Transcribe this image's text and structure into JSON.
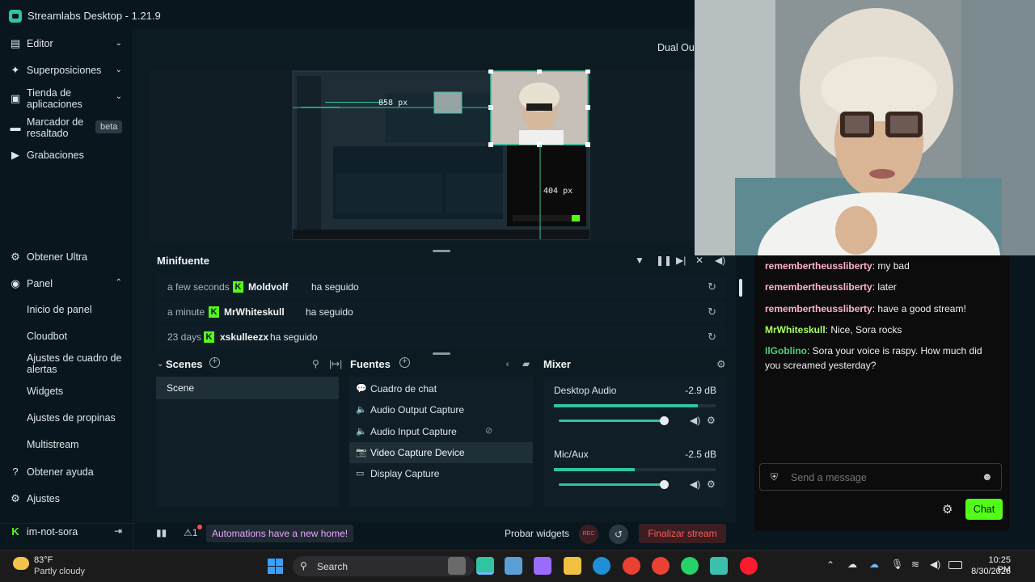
{
  "window": {
    "title": "Streamlabs Desktop - 1.21.9"
  },
  "sidebar": {
    "items": [
      {
        "label": "Editor",
        "icon": "editor-icon"
      },
      {
        "label": "Superposiciones",
        "icon": "overlays-icon"
      },
      {
        "label": "Tienda de aplicaciones",
        "icon": "app-store-icon"
      },
      {
        "label": "Marcador de resaltado",
        "icon": "highlighter-icon",
        "badge": "beta"
      },
      {
        "label": "Grabaciones",
        "icon": "recordings-icon"
      }
    ],
    "lower": [
      {
        "label": "Obtener Ultra",
        "icon": "ultra-icon"
      },
      {
        "label": "Panel",
        "icon": "dashboard-icon"
      }
    ],
    "sub_items": [
      "Inicio de panel",
      "Cloudbot",
      "Ajustes de cuadro de alertas",
      "Widgets",
      "Ajustes de propinas",
      "Multistream"
    ],
    "bottom": [
      {
        "label": "Obtener ayuda",
        "icon": "help-icon"
      },
      {
        "label": "Ajustes",
        "icon": "settings-icon"
      },
      {
        "label": "im-not-sora",
        "icon": "kick-icon"
      }
    ]
  },
  "preview": {
    "dual_output_label": "Dual Outp",
    "inner": {
      "width_readout": "858 px",
      "height_readout": "404 px"
    }
  },
  "minifuente": {
    "title": "Minifuente",
    "events": [
      {
        "time": "a few seconds",
        "user": "Moldvolf",
        "action": "ha seguido"
      },
      {
        "time": "a minute",
        "user": "MrWhiteskull",
        "action": "ha seguido"
      },
      {
        "time": "23 days",
        "user": "xskulleezx",
        "action": "ha seguido"
      }
    ]
  },
  "scenes": {
    "title": "Scenes",
    "items": [
      "Scene"
    ]
  },
  "fuentes": {
    "title": "Fuentes",
    "items": [
      {
        "label": "Cuadro de chat",
        "icon": "chat-box-icon"
      },
      {
        "label": "Audio Output Capture",
        "icon": "speaker-icon"
      },
      {
        "label": "Audio Input Capture",
        "icon": "speaker-icon"
      },
      {
        "label": "Video Capture Device",
        "icon": "camera-icon"
      },
      {
        "label": "Display Capture",
        "icon": "monitor-icon"
      }
    ]
  },
  "mixer": {
    "title": "Mixer",
    "channels": [
      {
        "name": "Desktop Audio",
        "db": "-2.9 dB",
        "level": 0.89,
        "volume": 0.97
      },
      {
        "name": "Mic/Aux",
        "db": "-2.5 dB",
        "level": 0.5,
        "volume": 0.97
      }
    ]
  },
  "footer": {
    "automations": "Automations have a new home!",
    "test_widgets": "Probar widgets",
    "rec": "REC",
    "end_stream": "Finalizar stream"
  },
  "chat": {
    "messages": [
      {
        "user": "remembertheussliberty",
        "text": ": my bad",
        "color": "#ffb3c7"
      },
      {
        "user": "remembertheussliberty",
        "text": ": later",
        "color": "#ffb3c7"
      },
      {
        "user": "remembertheussliberty",
        "text": ": have a good stream!",
        "color": "#ffb3c7"
      },
      {
        "user": "MrWhiteskull",
        "text": ": Nice, Sora rocks",
        "color": "#a8ff60"
      },
      {
        "user": "IlGoblino",
        "text": ": Sora your voice is raspy. How much did you screamed yesterday?",
        "color": "#4cd07a"
      }
    ],
    "input_placeholder": "Send a message",
    "send_label": "Chat"
  },
  "taskbar": {
    "weather_temp": "83°F",
    "weather_desc": "Partly cloudy",
    "search_label": "Search",
    "time": "10:25 PM",
    "date": "8/30/2026"
  },
  "colors": {
    "accent": "#31c3a2",
    "kick_green": "#53fc18",
    "danger": "#ff5a5a",
    "background": "#09161d"
  }
}
